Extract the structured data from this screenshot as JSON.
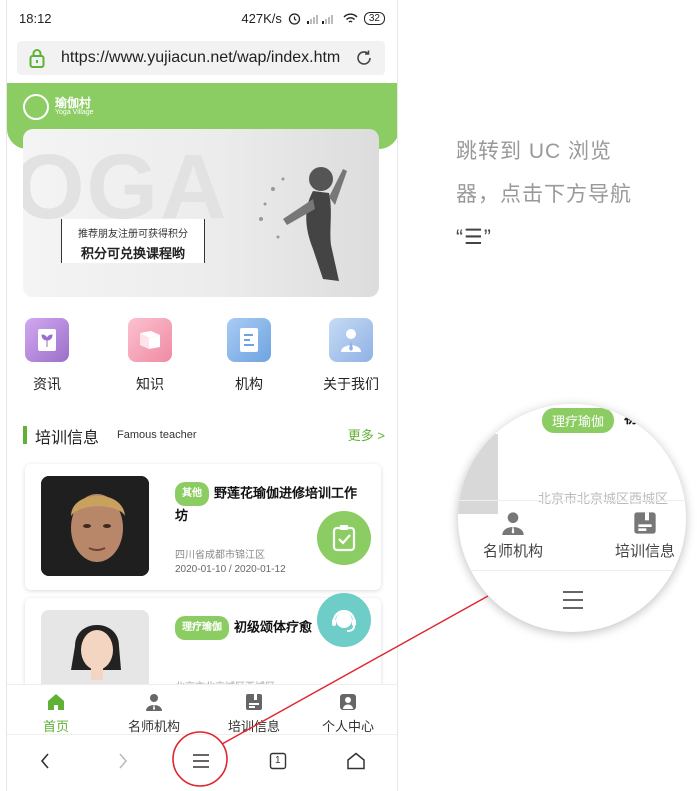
{
  "status_bar": {
    "time": "18:12",
    "speed": "427K/s",
    "battery": "32"
  },
  "browser": {
    "url": "https://www.yujiacun.net/wap/index.htm"
  },
  "site": {
    "logo_title": "瑜伽村",
    "logo_subtitle": "Yoga Village",
    "banner": {
      "yoga_text": "OGA",
      "promo_line1": "推荐朋友注册可获得积分",
      "promo_line2": "积分可兑换课程哟"
    },
    "categories": [
      {
        "label": "资讯",
        "icon": "sprout-icon",
        "color": "#b98ad8"
      },
      {
        "label": "知识",
        "icon": "book-icon",
        "color": "#f4a3b5"
      },
      {
        "label": "机构",
        "icon": "document-icon",
        "color": "#8ab8ea"
      },
      {
        "label": "关于我们",
        "icon": "person-icon",
        "color": "#a9c4ea"
      }
    ],
    "section": {
      "title": "培训信息",
      "subtitle": "Famous teacher",
      "more": "更多 >"
    },
    "cards": [
      {
        "tag": "其他",
        "title": "野莲花瑜伽进修培训工作坊",
        "location": "四川省成都市锦江区",
        "dates": "2020-01-10 / 2020-01-12"
      },
      {
        "tag": "理疗瑜伽",
        "title": "初级颂体疗愈",
        "location": "北京市北京城区西城区"
      }
    ],
    "bottom_nav": [
      {
        "label": "首页",
        "icon": "home-icon"
      },
      {
        "label": "名师机构",
        "icon": "teacher-icon"
      },
      {
        "label": "培训信息",
        "icon": "info-icon"
      },
      {
        "label": "个人中心",
        "icon": "user-icon"
      }
    ]
  },
  "browser_nav": [
    "back-icon",
    "forward-icon",
    "menu-icon",
    "tabs-icon",
    "home-icon"
  ],
  "browser_tabs_count": "1",
  "annotation": {
    "line1": "跳转到 UC 浏览",
    "line2": "器，点击下方导航",
    "line3": "“☰”"
  },
  "zoom": {
    "tag": "理疗瑜伽",
    "title_fragment": "初",
    "location_fragment": "北京市北京城区西城区",
    "nav_left": "名师机构",
    "nav_right": "培训信息"
  },
  "colors": {
    "accent": "#8ccd63",
    "accent_dark": "#5fb236",
    "annotation_red": "#e0242b"
  }
}
